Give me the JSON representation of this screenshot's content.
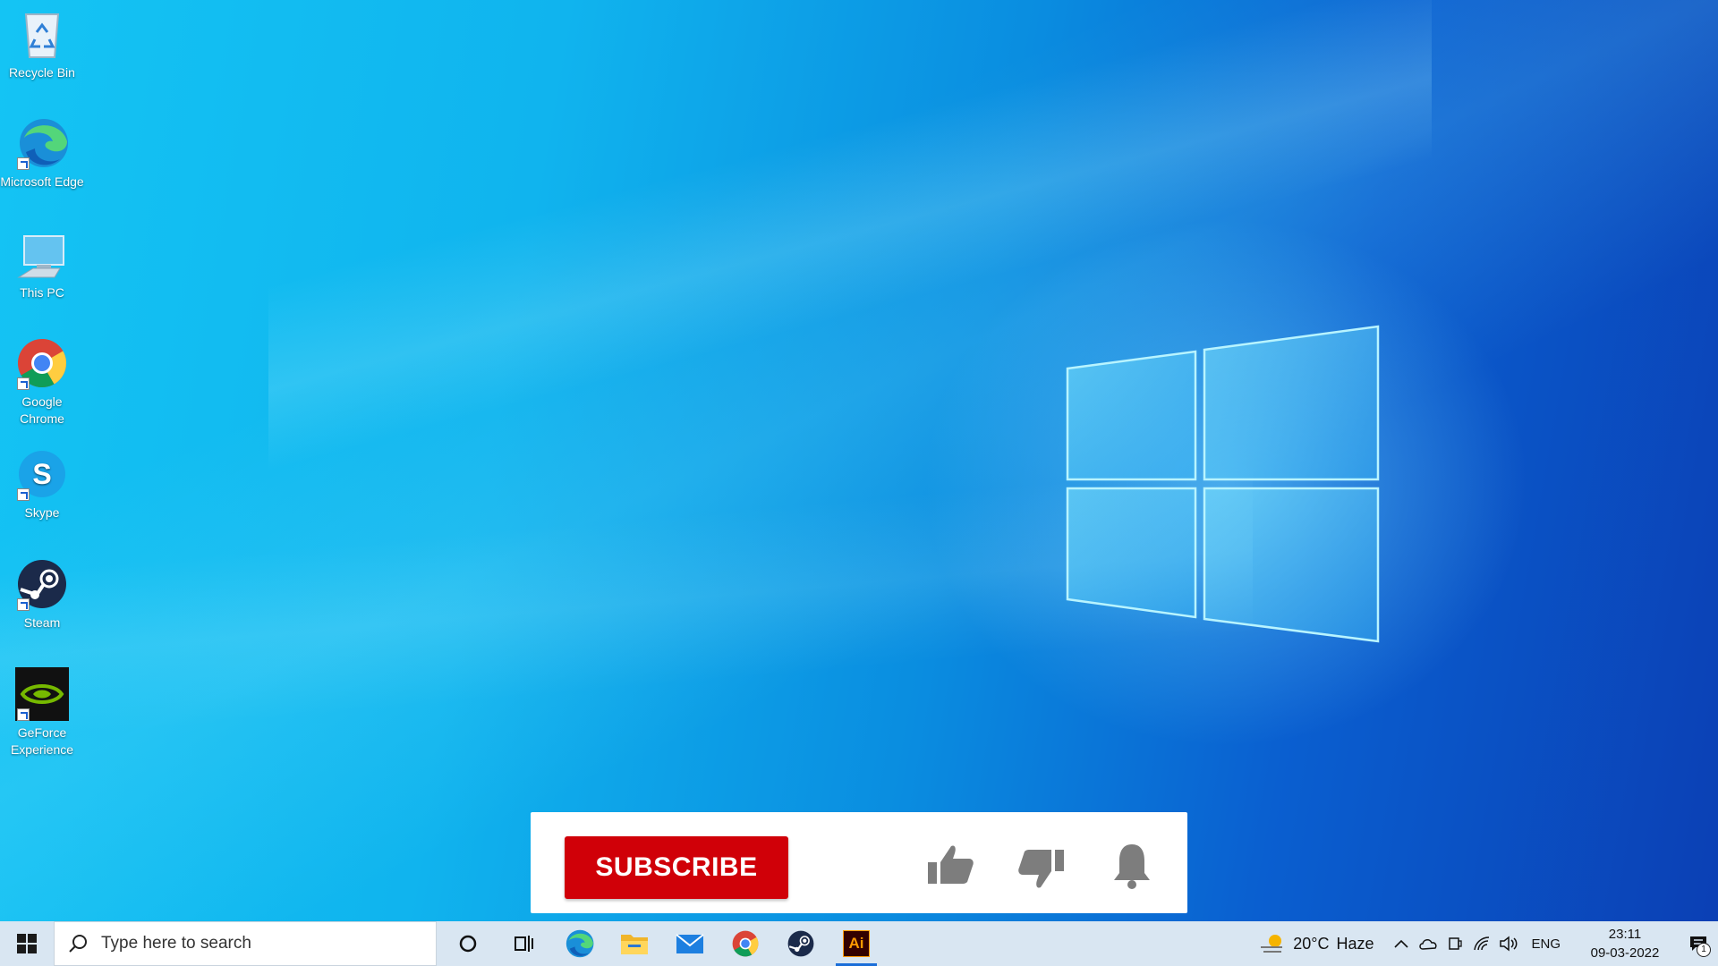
{
  "desktop": {
    "icons": [
      {
        "label": "Recycle Bin",
        "icon": "recycle-bin-icon"
      },
      {
        "label": "Microsoft Edge",
        "icon": "edge-icon"
      },
      {
        "label": "This PC",
        "icon": "this-pc-icon"
      },
      {
        "label": "Google Chrome",
        "icon": "chrome-icon"
      },
      {
        "label": "Skype",
        "icon": "skype-icon"
      },
      {
        "label": "Steam",
        "icon": "steam-icon"
      },
      {
        "label": "GeForce Experience",
        "icon": "geforce-icon"
      }
    ]
  },
  "banner": {
    "subscribe_label": "SUBSCRIBE",
    "like_icon": "thumbs-up-icon",
    "dislike_icon": "thumbs-down-icon",
    "bell_icon": "bell-icon",
    "accent": "#d00008"
  },
  "taskbar": {
    "search_placeholder": "Type here to search",
    "pinned": [
      {
        "icon": "cortana-icon"
      },
      {
        "icon": "task-view-icon"
      },
      {
        "icon": "edge-icon"
      },
      {
        "icon": "file-explorer-icon"
      },
      {
        "icon": "mail-icon"
      },
      {
        "icon": "chrome-icon"
      },
      {
        "icon": "steam-icon"
      },
      {
        "icon": "illustrator-icon",
        "label": "Ai",
        "active": true
      }
    ],
    "weather": {
      "temp": "20°C",
      "condition": "Haze"
    },
    "language": "ENG",
    "time": "23:11",
    "date": "09-03-2022",
    "notification_count": "1"
  }
}
